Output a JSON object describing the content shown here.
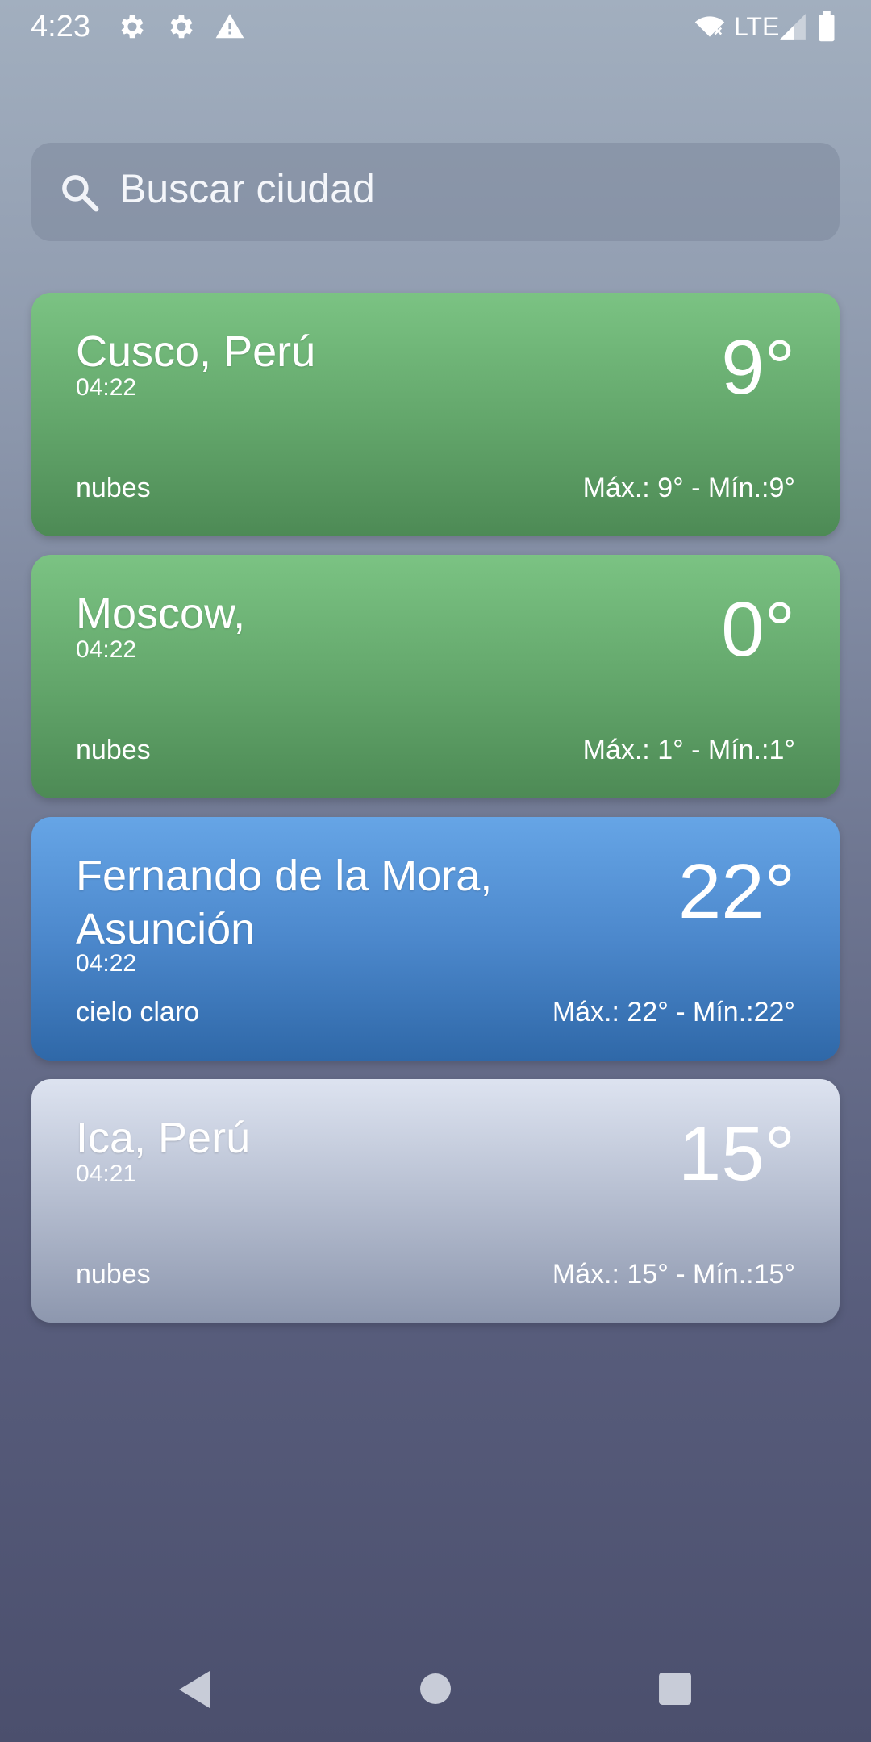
{
  "status_bar": {
    "time": "4:23",
    "network": "LTE",
    "icons": [
      "settings-icon",
      "settings-icon",
      "warning-icon",
      "wifi-icon",
      "signal-icon",
      "battery-icon"
    ]
  },
  "search": {
    "placeholder": "Buscar ciudad",
    "icon": "search-icon"
  },
  "cities": [
    {
      "name": "Cusco, Perú",
      "time": "04:22",
      "temp": "9°",
      "description": "nubes",
      "minmax": "Máx.: 9° - Mín.:9°",
      "theme": "green",
      "color": "#6aaf72"
    },
    {
      "name": "Moscow,",
      "time": "04:22",
      "temp": "0°",
      "description": "nubes",
      "minmax": "Máx.: 1° - Mín.:1°",
      "theme": "green",
      "color": "#6aaf72"
    },
    {
      "name": "Fernando de la Mora, Asunción",
      "time": "04:22",
      "temp": "22°",
      "description": "cielo claro",
      "minmax": "Máx.: 22° - Mín.:22°",
      "theme": "blue",
      "color": "#4c88cc"
    },
    {
      "name": "Ica, Perú",
      "time": "04:21",
      "temp": "15°",
      "description": "nubes",
      "minmax": "Máx.: 15° - Mín.:15°",
      "theme": "grey",
      "color": "#b9c1d3"
    }
  ],
  "nav_bar": {
    "buttons": [
      "back-icon",
      "home-icon",
      "recents-icon"
    ]
  }
}
